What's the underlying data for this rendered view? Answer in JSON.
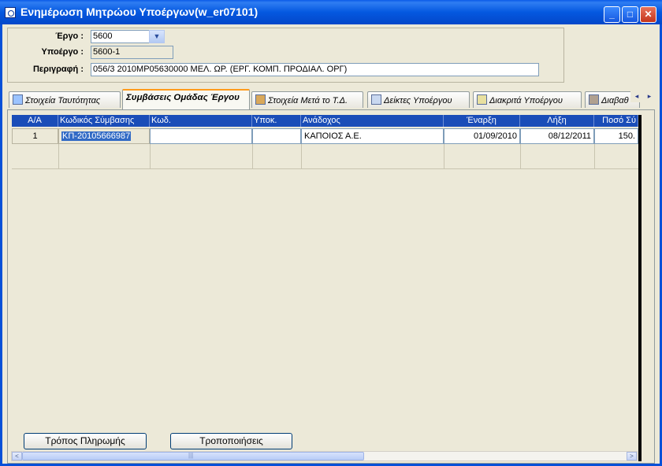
{
  "window": {
    "title": "Ενημέρωση Μητρώου Υποέργων(w_er07101)",
    "minimize": "_",
    "maximize": "□",
    "close": "✕"
  },
  "header": {
    "ergo_label": "Έργο :",
    "ergo_value": "5600",
    "ypoergo_label": "Υποέργο :",
    "ypoergo_value": "5600-1",
    "perigrafi_label": "Περιγραφή :",
    "perigrafi_value": "056/3 2010ΜΡ05630000 ΜΕΛ. ΩΡ. (ΕΡΓ. ΚΟΜΠ. ΠΡΟΔΙΑΛ. ΟΡΓ)"
  },
  "tabs": [
    {
      "label": "Στοιχεία Ταυτότητας",
      "icon": "identity-icon"
    },
    {
      "label": "Συμβάσεις Ομάδας Έργου",
      "icon": ""
    },
    {
      "label": "Στοιχεία Μετά το Τ.Δ.",
      "icon": "box-icon"
    },
    {
      "label": "Δείκτες Υποέργου",
      "icon": "indicator-icon"
    },
    {
      "label": "Διακριτά Υποέργου",
      "icon": "list-icon"
    },
    {
      "label": "Διαβαθ",
      "icon": "grid-icon"
    }
  ],
  "tab_scroll": {
    "left": "◂",
    "right": "▸"
  },
  "grid": {
    "columns": [
      "Α/Α",
      "Κωδικός Σύμβασης",
      "Κωδ.",
      "Υποκ.",
      "Ανάδοχος",
      "Έναρξη",
      "Λήξη",
      "Ποσό Σύ"
    ],
    "rows": [
      [
        "1",
        "ΚΠ-20105666987",
        "",
        "",
        "ΚΑΠΟΙΟΣ Α.Ε.",
        "01/09/2010",
        "08/12/2011",
        "150."
      ]
    ]
  },
  "buttons": {
    "payment": "Τρόπος Πληρωμής",
    "amendments": "Τροποποιήσεις"
  },
  "scrollbar": {
    "left": "<",
    "right": ">",
    "thumb_grip": "|||"
  },
  "colors": {
    "titlebar": "#0458e0",
    "grid_header": "#1a4db8",
    "selection": "#316ac5",
    "active_tab_accent": "#ff9c1c"
  }
}
